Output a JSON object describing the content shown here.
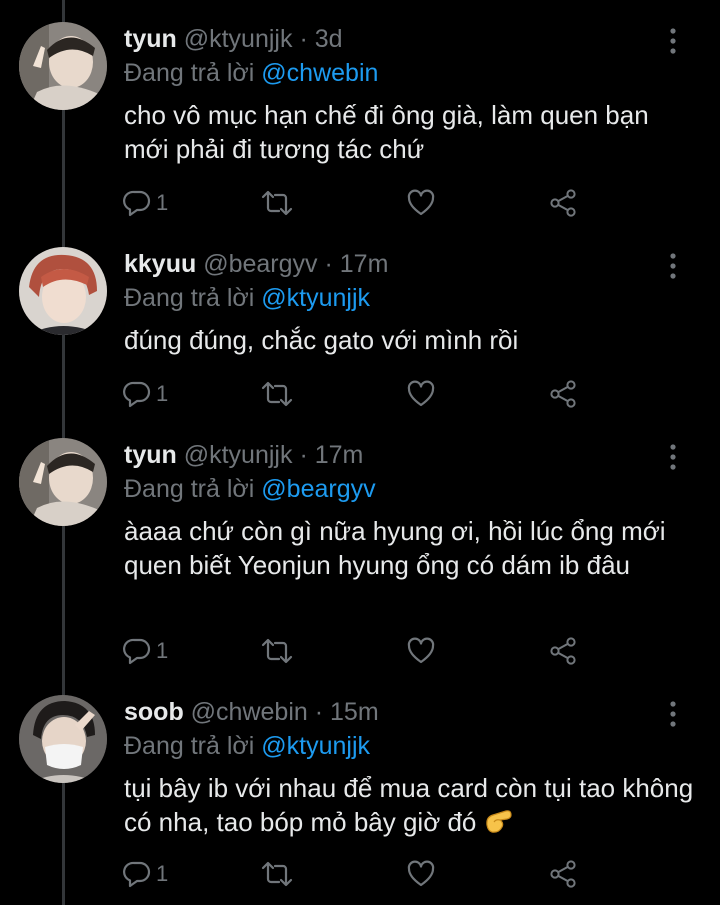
{
  "tweets": [
    {
      "name": "tyun",
      "handle": "@ktyunjjk",
      "time": "3d",
      "reply_prefix": "Đang trả lời",
      "reply_mention": "@chwebin",
      "text": "cho vô mục hạn chế đi ông già, làm quen bạn mới phải đi tương tác chứ",
      "reply_count": "1",
      "avatar": "avatar-tyun"
    },
    {
      "name": "kkyuu",
      "handle": "@beargyv",
      "time": "17m",
      "reply_prefix": "Đang trả lời",
      "reply_mention": "@ktyunjjk",
      "text": "đúng đúng, chắc gato với mình rồi",
      "reply_count": "1",
      "avatar": "avatar-kkyuu"
    },
    {
      "name": "tyun",
      "handle": "@ktyunjjk",
      "time": "17m",
      "reply_prefix": "Đang trả lời",
      "reply_mention": "@beargyv",
      "text": "àaaa chứ còn gì nữa hyung ơi, hồi lúc ổng mới quen biết Yeonjun hyung ổng có dám ib đâu",
      "reply_count": "1",
      "avatar": "avatar-tyun"
    },
    {
      "name": "soob",
      "handle": "@chwebin",
      "time": "15m",
      "reply_prefix": "Đang trả lời",
      "reply_mention": "@ktyunjjk",
      "text": "tụi bây ib với nhau để mua card còn tụi tao không có nha, tao bóp mỏ bây giờ đó",
      "emoji": "pinching-hand-emoji",
      "reply_count": "1",
      "avatar": "avatar-soob"
    }
  ],
  "separator": "·",
  "colors": {
    "background": "#000000",
    "text": "#e7e9ea",
    "muted": "#71767b",
    "mention": "#1d9bf0",
    "thread_line": "#333639"
  },
  "icons": {
    "reply": "reply-icon",
    "retweet": "retweet-icon",
    "like": "heart-icon",
    "share": "share-icon",
    "more": "more-vertical-icon"
  }
}
